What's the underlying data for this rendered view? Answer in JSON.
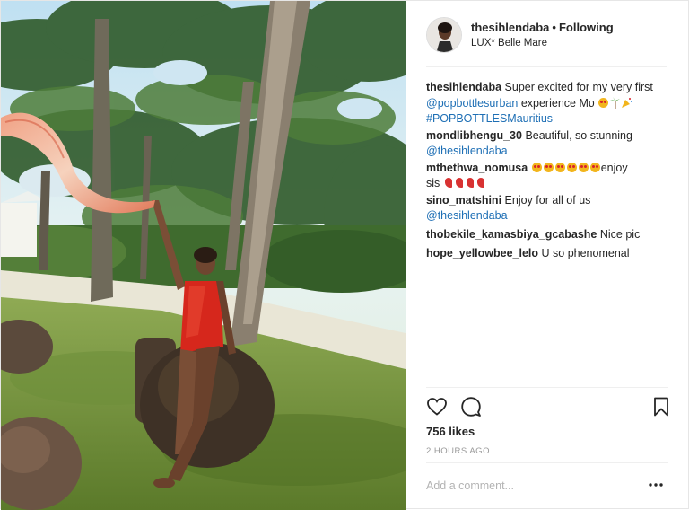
{
  "post": {
    "username": "thesihlendaba",
    "follow_separator": "•",
    "follow_label": "Following",
    "location": "LUX* Belle Mare"
  },
  "comments": [
    {
      "user": "thesihlendaba",
      "parts": [
        "Super excited for my very first",
        "@popbottlesurban",
        "experience Μυ",
        "#POPBOTTLESMauritius"
      ]
    },
    {
      "user": "mondlibhengu_30",
      "text": "Beautiful, so stunning",
      "mention": "@thesihlendaba"
    },
    {
      "user": "mthethwa_nomusa",
      "text": "enjoy",
      "text2": "sis"
    },
    {
      "user": "sino_matshini",
      "text": "Enjoy for all of us",
      "mention": "@thesihlendaba"
    },
    {
      "user": "thobekile_kamasbiya_gcabashe",
      "text": "Nice pic"
    },
    {
      "user": "hope_yellowbee_lelo",
      "text": "U so phenomenal"
    }
  ],
  "actions": {
    "like_icon": "heart-icon",
    "comment_icon": "comment-bubble-icon",
    "save_icon": "bookmark-icon"
  },
  "likes": "756 likes",
  "timestamp": "2 HOURS AGO",
  "add_comment": {
    "placeholder": "Add a comment..."
  },
  "colors": {
    "link": "#1e6fb5",
    "text": "#262626",
    "muted": "#999999"
  }
}
